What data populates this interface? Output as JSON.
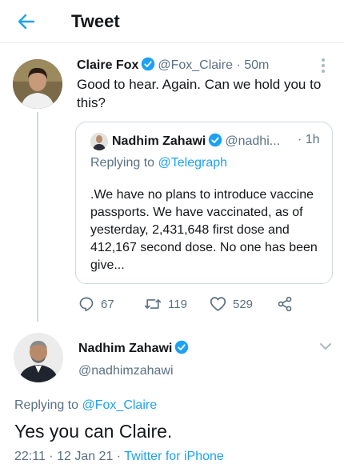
{
  "header": {
    "title": "Tweet"
  },
  "colors": {
    "accent": "#1da1f2",
    "secondary_text": "#5b7083",
    "border": "#cfd9de"
  },
  "tweet1": {
    "name": "Claire Fox",
    "handle": "@Fox_Claire",
    "time": "· 50m",
    "text": "Good to hear. Again. Can we hold you to this?",
    "quoted": {
      "name": "Nadhim Zahawi",
      "handle": "@nadhi...",
      "time": "· 1h",
      "replying_prefix": "Replying to",
      "replying_to": "@Telegraph",
      "text": ".We have no plans to introduce vaccine passports. We have vaccinated, as of yesterday, 2,431,648 first dose and 412,167 second dose. No one has been give..."
    },
    "stats": {
      "replies": "67",
      "retweets": "119",
      "likes": "529"
    }
  },
  "tweet2": {
    "name": "Nadhim Zahawi",
    "handle": "@nadhimzahawi",
    "replying_prefix": "Replying to",
    "replying_to": "@Fox_Claire",
    "text": "Yes you can Claire.",
    "time": "22:11 · 12 Jan 21 · ",
    "source": "Twitter for iPhone"
  },
  "icons": [
    "back-arrow-icon",
    "verified-badge-icon",
    "more-icon",
    "reply-icon",
    "retweet-icon",
    "like-icon",
    "share-icon",
    "chevron-down-icon"
  ]
}
